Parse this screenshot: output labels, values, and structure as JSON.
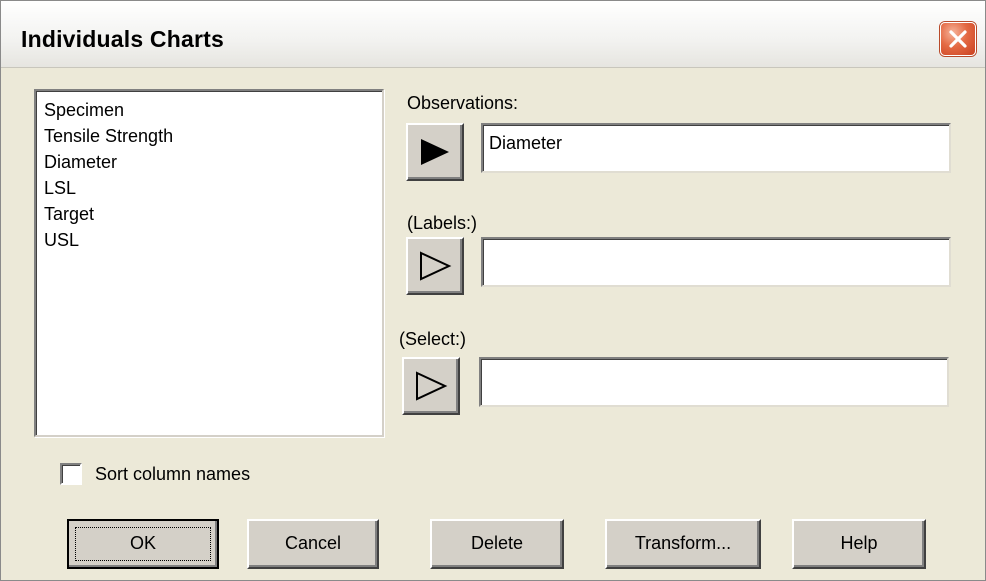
{
  "window": {
    "title": "Individuals Charts",
    "close_icon": "close-x-icon"
  },
  "column_list": {
    "items": [
      "Specimen",
      "Tensile Strength",
      "Diameter",
      "LSL",
      "Target",
      "USL"
    ]
  },
  "observations": {
    "label": "Observations:",
    "value": "Diameter",
    "arrow_icon": "filled-right-arrow-icon"
  },
  "labels_field": {
    "label": "(Labels:)",
    "value": "",
    "arrow_icon": "outline-right-arrow-icon"
  },
  "select_field": {
    "label": "(Select:)",
    "value": "",
    "arrow_icon": "outline-right-arrow-icon"
  },
  "sort_option": {
    "label": "Sort column names",
    "checked": false
  },
  "buttons": {
    "ok": "OK",
    "cancel": "Cancel",
    "delete": "Delete",
    "transform": "Transform...",
    "help": "Help"
  },
  "colors": {
    "dialog_bg": "#ece9d8",
    "close_red": "#e46a44"
  }
}
